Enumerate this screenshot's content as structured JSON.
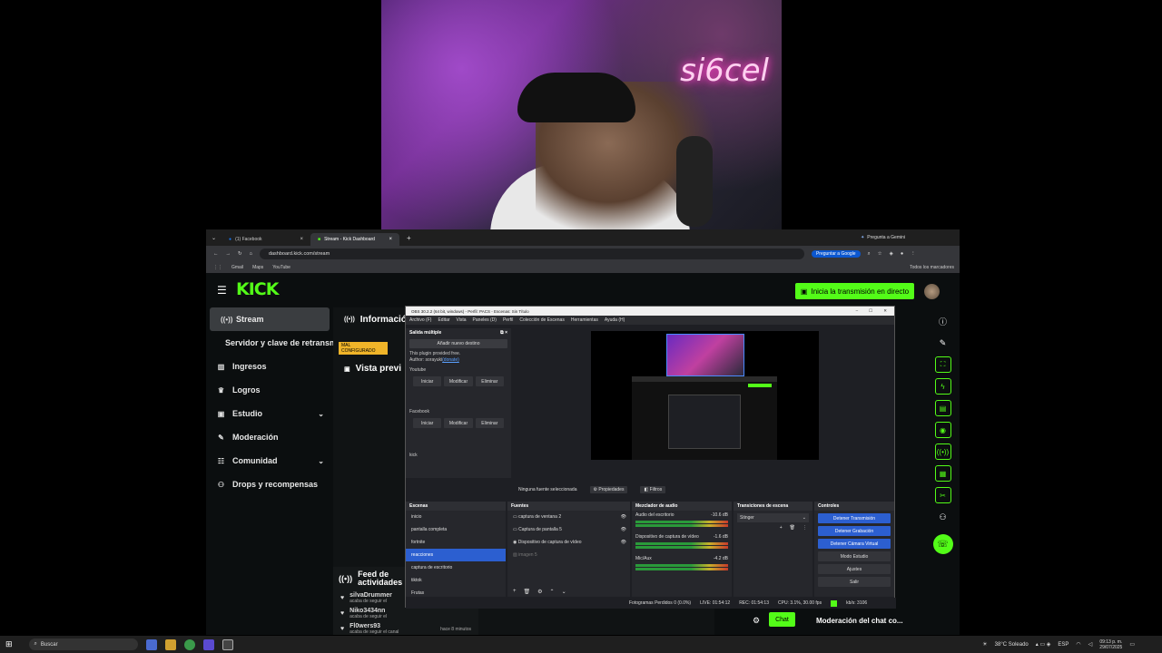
{
  "webcam": {
    "neon_text": "si6cel"
  },
  "browser": {
    "tabs": [
      {
        "label": "(1) Facebook"
      },
      {
        "label": "Stream - Kick Dashboard"
      }
    ],
    "gemini_button": "Pregunta a Gemini",
    "url": "dashboard.kick.com/stream",
    "google_button": "Preguntar a Google",
    "bookmarks": [
      "Gmail",
      "Maps",
      "YouTube"
    ],
    "all_bookmarks": "Todos los marcadores"
  },
  "kick": {
    "logo": "KICK",
    "go_live_button": "Inicia la transmisión en directo",
    "sidebar": {
      "items": [
        {
          "label": "Stream",
          "icon": "broadcast-icon"
        },
        {
          "label": "Servidor y clave de retransmisión"
        },
        {
          "label": "Ingresos",
          "icon": "chart-icon"
        },
        {
          "label": "Logros",
          "icon": "trophy-icon"
        },
        {
          "label": "Estudio",
          "icon": "studio-icon"
        },
        {
          "label": "Moderación",
          "icon": "wrench-icon"
        },
        {
          "label": "Comunidad",
          "icon": "community-icon"
        },
        {
          "label": "Drops y recompensas",
          "icon": "drops-icon"
        }
      ]
    },
    "main": {
      "info_title": "Informació",
      "warning_badge": "MAL CONFIGURADO",
      "preview_title": "Vista previ"
    },
    "feed": {
      "title": "Feed de actividades",
      "entries": [
        {
          "user": "silvaDrummer",
          "action": "acaba de seguir el",
          "time": ""
        },
        {
          "user": "Niko3434nn",
          "action": "acaba de seguir el",
          "time": ""
        },
        {
          "user": "Fl0wers93",
          "action": "acaba de seguir el canal",
          "time": "hace 8 minutos"
        }
      ]
    },
    "chat_button": "Chat",
    "chat_mod_label": "Moderación del chat co..."
  },
  "obs": {
    "title": "OBS 30.2.2 (64 bit, windows) - Perfil: PACS - Escenas: Sin Título",
    "menu": [
      "Archivo (F)",
      "Editar",
      "Vista",
      "Paneles (D)",
      "Perfil",
      "Colección de Escenas",
      "Herramientas",
      "Ayuda (H)"
    ],
    "multi_output": {
      "title": "Salida múltiple",
      "add_button": "Añadir nuevo destino",
      "plugin_text": "This plugin provided free.",
      "author_text": "Author: sorayuki",
      "author_link": "(donate)",
      "targets": [
        {
          "name": "Youtube",
          "buttons": [
            "Iniciar",
            "Modificar",
            "Eliminar"
          ]
        },
        {
          "name": "Facebook",
          "buttons": [
            "Iniciar",
            "Modificar",
            "Eliminar"
          ]
        }
      ],
      "extra": "kick"
    },
    "source_bar": {
      "none_selected": "Ninguna fuente seleccionada",
      "properties": "Propiedades",
      "filters": "Filtros"
    },
    "scenes": {
      "title": "Escenas",
      "items": [
        "inicio",
        "pantalla completa",
        "fortnite",
        "reacciones",
        "captura de escritorio",
        "tiktok",
        "Frutas"
      ],
      "selected": "reacciones"
    },
    "sources": {
      "title": "Fuentes",
      "items": [
        "captura de ventana 2",
        "Captura de pantalla 5",
        "Dispositivo de captura de vídeo",
        "imagen 5"
      ]
    },
    "mixer": {
      "title": "Mezclador de audio",
      "channels": [
        {
          "name": "Audio del escritorio",
          "level": "-10.6 dB"
        },
        {
          "name": "Dispositivo de captura de vídeo",
          "level": "-1.6 dB"
        },
        {
          "name": "Mic/Aux",
          "level": "-4.2 dB"
        }
      ]
    },
    "transitions": {
      "title": "Transiciones de escena",
      "selected": "Stinger"
    },
    "controls": {
      "title": "Controles",
      "buttons": [
        "Detener Transmisión",
        "Detener Grabación",
        "Detener Cámara Virtual",
        "Modo Estudio",
        "Ajustes",
        "Salir"
      ]
    },
    "status": {
      "dropped": "Fotogramas Perdidos 0 (0.0%)",
      "live": "LIVE: 01:54:12",
      "rec": "REC: 01:54:13",
      "cpu": "CPU: 3.1%, 30.00 fps",
      "bitrate": "kb/s: 3106"
    }
  },
  "taskbar": {
    "search": "Buscar",
    "weather": "38°C  Soleado",
    "lang": "ESP",
    "time": "09:13 p. m.",
    "date": "29/07/2025"
  }
}
